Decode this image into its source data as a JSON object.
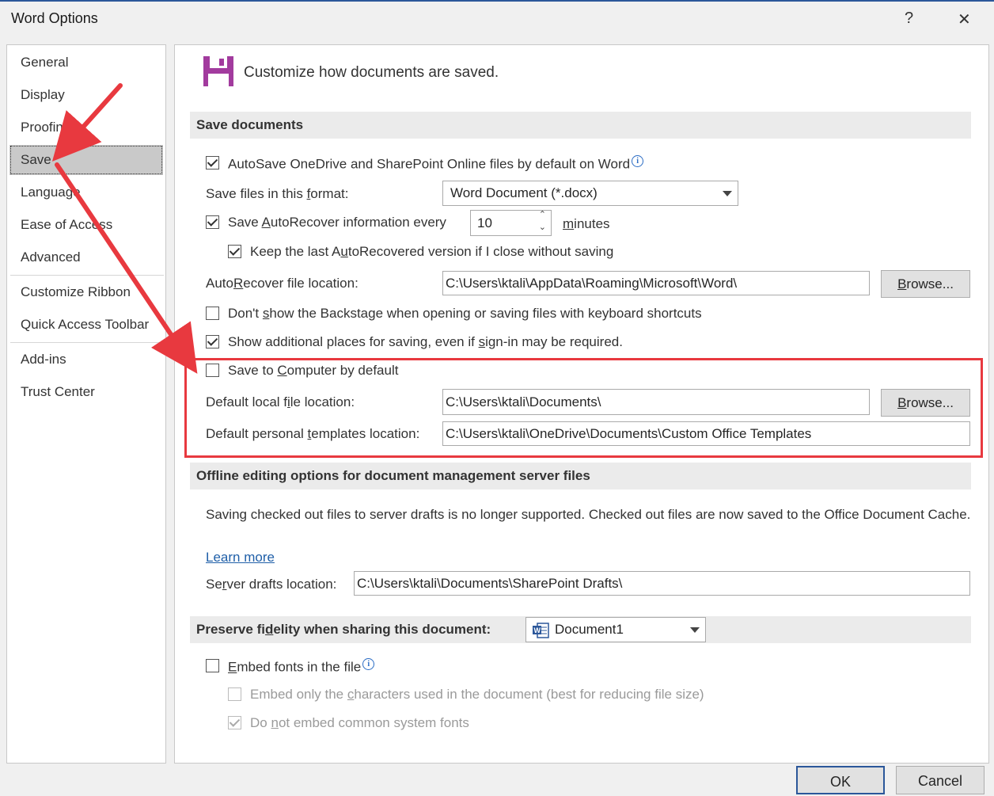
{
  "window": {
    "title": "Word Options",
    "help_glyph": "?",
    "close_glyph": "✕"
  },
  "nav": {
    "items": [
      "General",
      "Display",
      "Proofing",
      "Save",
      "Language",
      "Ease of Access",
      "Advanced",
      "Customize Ribbon",
      "Quick Access Toolbar",
      "Add-ins",
      "Trust Center"
    ],
    "selected": "Save"
  },
  "header": {
    "text": "Customize how documents are saved.",
    "icon": "save-floppy-icon"
  },
  "save_documents": {
    "title": "Save documents",
    "autosave": {
      "label": "AutoSave OneDrive and SharePoint Online files by default on Word",
      "checked": true
    },
    "format_label": "Save files in this format:",
    "format_value": "Word Document (*.docx)",
    "autorecover": {
      "label": "Save AutoRecover information every",
      "checked": true,
      "value": "10",
      "unit": "minutes"
    },
    "keep_last": {
      "label": "Keep the last AutoRecovered version if I close without saving",
      "checked": true
    },
    "autorecover_location_label": "AutoRecover file location:",
    "autorecover_location": "C:\\Users\\ktali\\AppData\\Roaming\\Microsoft\\Word\\",
    "browse_label": "Browse...",
    "no_backstage": {
      "label": "Don't show the Backstage when opening or saving files with keyboard shortcuts",
      "checked": false
    },
    "show_places": {
      "label": "Show additional places for saving, even if sign-in may be required.",
      "checked": true
    },
    "save_to_computer": {
      "label": "Save to Computer by default",
      "checked": false
    },
    "default_local_label": "Default local file location:",
    "default_local": "C:\\Users\\ktali\\Documents\\",
    "templates_label": "Default personal templates location:",
    "templates": "C:\\Users\\ktali\\OneDrive\\Documents\\Custom Office Templates"
  },
  "offline": {
    "title": "Offline editing options for document management server files",
    "description": "Saving checked out files to server drafts is no longer supported. Checked out files are now saved to the Office Document Cache.",
    "learn_more": "Learn more",
    "drafts_label": "Server drafts location:",
    "drafts_value": "C:\\Users\\ktali\\Documents\\SharePoint Drafts\\"
  },
  "fidelity": {
    "title": "Preserve fidelity when sharing this document:",
    "document": "Document1",
    "embed_fonts": {
      "label": "Embed fonts in the file",
      "checked": false
    },
    "embed_chars": {
      "label": "Embed only the characters used in the document (best for reducing file size)",
      "checked": false,
      "disabled": true
    },
    "no_common": {
      "label": "Do not embed common system fonts",
      "checked": true,
      "disabled": true
    }
  },
  "footer": {
    "ok": "OK",
    "cancel": "Cancel"
  },
  "colors": {
    "annotation_red": "#e8393f",
    "save_icon": "#a23b9e",
    "link": "#1f5fa8"
  }
}
